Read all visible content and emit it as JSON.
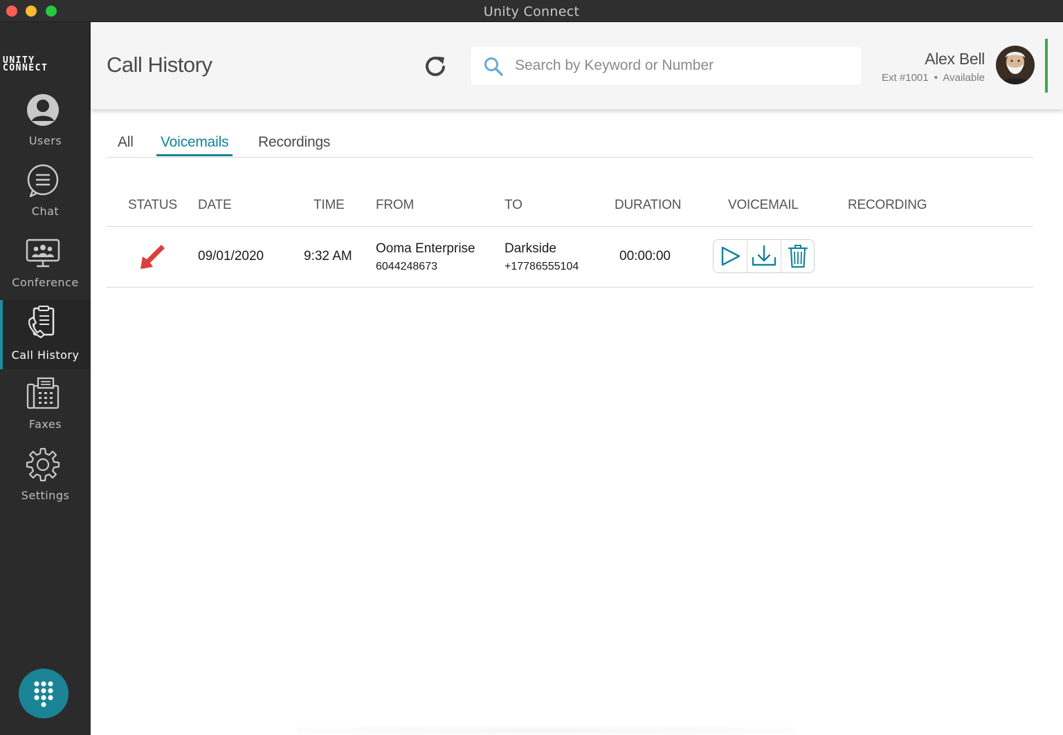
{
  "window": {
    "title": "Unity Connect"
  },
  "sidebar": {
    "logo_line1": "UNITY",
    "logo_line2": "CONNECT",
    "items": [
      {
        "label": "Users",
        "icon": "user-icon"
      },
      {
        "label": "Chat",
        "icon": "chat-icon"
      },
      {
        "label": "Conference",
        "icon": "conference-icon"
      },
      {
        "label": "Call History",
        "icon": "call-history-icon",
        "active": true
      },
      {
        "label": "Faxes",
        "icon": "fax-icon"
      },
      {
        "label": "Settings",
        "icon": "gear-icon"
      }
    ],
    "dialpad_icon": "dialpad-icon"
  },
  "header": {
    "title": "Call History",
    "refresh_icon": "refresh-icon",
    "search": {
      "placeholder": "Search by Keyword or Number",
      "value": ""
    },
    "user": {
      "name": "Alex Bell",
      "ext": "Ext #1001",
      "separator": "•",
      "status": "Available"
    }
  },
  "tabs": [
    {
      "label": "All",
      "active": false
    },
    {
      "label": "Voicemails",
      "active": true
    },
    {
      "label": "Recordings",
      "active": false
    }
  ],
  "table": {
    "columns": [
      "STATUS",
      "DATE",
      "TIME",
      "FROM",
      "TO",
      "DURATION",
      "VOICEMAIL",
      "RECORDING"
    ],
    "rows": [
      {
        "status_icon": "incoming-call-arrow-icon",
        "date": "09/01/2020",
        "time": "9:32 AM",
        "from_name": "Ooma Enterprise",
        "from_number": "6044248673",
        "to_name": "Darkside",
        "to_number": "+17786555104",
        "duration": "00:00:00",
        "voicemail_actions": [
          "play-icon",
          "download-icon",
          "trash-icon"
        ]
      }
    ]
  },
  "colors": {
    "accent": "#12839a",
    "sidebar_bg": "#2b2b2b",
    "status_available": "#3aaa4a",
    "incoming_arrow": "#d9403a"
  }
}
